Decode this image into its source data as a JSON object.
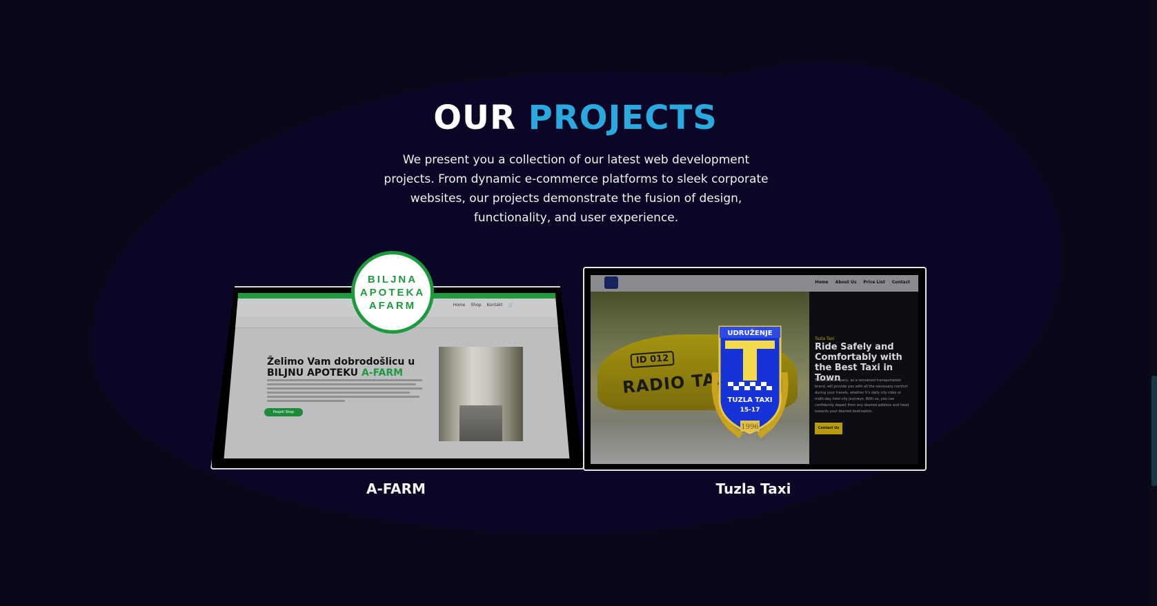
{
  "section": {
    "title_part1": "OUR",
    "title_part2": "PROJECTS",
    "description": "We present you a collection of our latest web development projects. From dynamic e-commerce platforms to sleek corporate websites, our projects demonstrate the fusion of design, functionality, and user experience."
  },
  "colors": {
    "background": "#090818",
    "accent": "#2aa9df",
    "afarm_green": "#1d9a3d",
    "taxi_gold": "#b89c07"
  },
  "projects": [
    {
      "title": "A-FARM",
      "badge_lines": [
        "BILJNA",
        "APOTEKA",
        "AFARM"
      ],
      "preview": {
        "nav_links": [
          "Home",
          "Shop",
          "Kontakt"
        ],
        "heading_line1": "Želimo Vam dobrodošlicu u",
        "heading_line2_prefix": "BILJNU APOTEKU",
        "heading_line2_brand": "A-FARM",
        "button": "Posjeti Shop",
        "cart_icon": "cart-icon"
      }
    },
    {
      "title": "Tuzla Taxi",
      "preview": {
        "nav_links": [
          "Home",
          "About Us",
          "Price List",
          "Contact"
        ],
        "kicker": "Tuzla Taxi",
        "heading": "Ride Safely and Comfortably with the Best Taxi in Town",
        "paragraph": "Tuzla taxi company, as a renowned transportation brand, will provide you with all the necessary comfort during your travels, whether it's daily city rides or multi-day inter-city journeys. With us, you can confidently depart from any desired address and head towards your desired destination.",
        "button": "Contact Us",
        "sign_id": "ID 012",
        "sign_text": "RADIO TAXI",
        "shield_top": "UDRUŽENJE",
        "shield_name": "TUZLA TAXI",
        "shield_num": "15-17",
        "shield_year": "1996"
      }
    }
  ]
}
